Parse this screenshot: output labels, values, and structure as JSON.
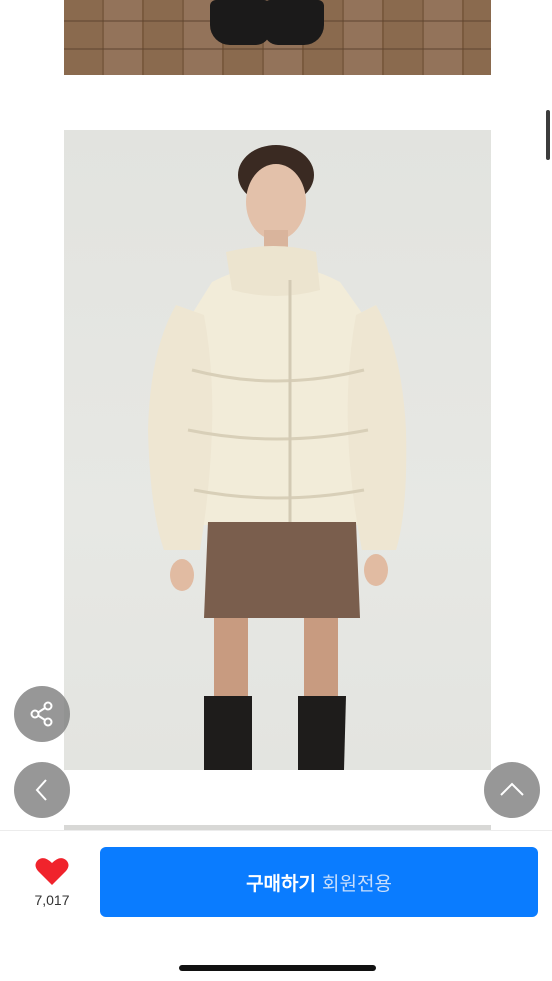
{
  "like": {
    "count": "7,017",
    "icon": "heart-icon",
    "color": "#f0232c"
  },
  "buy_button": {
    "label": "구매하기",
    "sublabel": "회원전용",
    "color": "#0a7cff"
  },
  "floating_buttons": {
    "share": "share-icon",
    "back": "chevron-left-icon",
    "top": "chevron-up-icon"
  }
}
